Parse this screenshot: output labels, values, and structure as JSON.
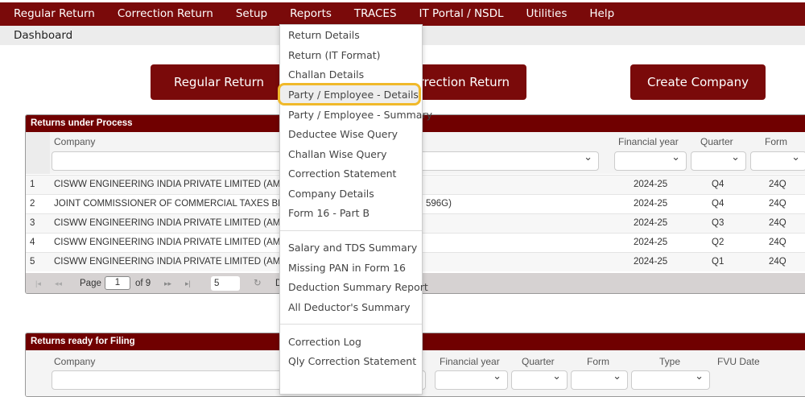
{
  "menu": [
    "Regular Return",
    "Correction Return",
    "Setup",
    "Reports",
    "TRACES",
    "IT Portal / NSDL",
    "Utilities",
    "Help"
  ],
  "breadcrumb": "Dashboard",
  "buttons": {
    "regular": "Regular Return",
    "correction": "Correction Return",
    "create": "Create Company"
  },
  "reports_menu": {
    "group1": [
      "Return Details",
      "Return (IT Format)",
      "Challan Details",
      "Party / Employee - Details",
      "Party / Employee - Summary",
      "Deductee Wise Query",
      "Challan Wise Query",
      "Correction Statement",
      "Company Details",
      "Form 16 - Part B"
    ],
    "group2": [
      "Salary and TDS Summary",
      "Missing PAN in Form 16",
      "Deduction Summary Report",
      "All Deductor's Summary"
    ],
    "group3": [
      "Correction Log",
      "Qly Correction Statement"
    ],
    "highlighted": "Party / Employee - Details"
  },
  "process": {
    "title": "Returns under Process",
    "cols": {
      "company": "Company",
      "fy": "Financial year",
      "quarter": "Quarter",
      "form": "Form"
    },
    "rows": [
      {
        "n": "1",
        "company": "CISWW ENGINEERING INDIA PRIVATE LIMITED (AMF",
        "fy": "2024-25",
        "q": "Q4",
        "form": "24Q"
      },
      {
        "n": "2",
        "company": "JOINT COMMISSIONER OF COMMERCIAL TAXES BE",
        "tail": "596G)",
        "fy": "2024-25",
        "q": "Q4",
        "form": "24Q"
      },
      {
        "n": "3",
        "company": "CISWW ENGINEERING INDIA PRIVATE LIMITED (AMF",
        "fy": "2024-25",
        "q": "Q3",
        "form": "24Q"
      },
      {
        "n": "4",
        "company": "CISWW ENGINEERING INDIA PRIVATE LIMITED (AMF",
        "fy": "2024-25",
        "q": "Q2",
        "form": "24Q"
      },
      {
        "n": "5",
        "company": "CISWW ENGINEERING INDIA PRIVATE LIMITED (AMF",
        "fy": "2024-25",
        "q": "Q1",
        "form": "24Q"
      }
    ],
    "pager": {
      "page_label": "Page",
      "page": "1",
      "of": "of 9",
      "size": "5",
      "d": "D"
    }
  },
  "filing": {
    "title": "Returns ready for Filing",
    "cols": {
      "company": "Company",
      "fy": "Financial year",
      "quarter": "Quarter",
      "form": "Form",
      "type": "Type",
      "fvu": "FVU Date"
    }
  },
  "colors": {
    "brand": "#7a0a0a",
    "highlight": "#f0b92a"
  }
}
